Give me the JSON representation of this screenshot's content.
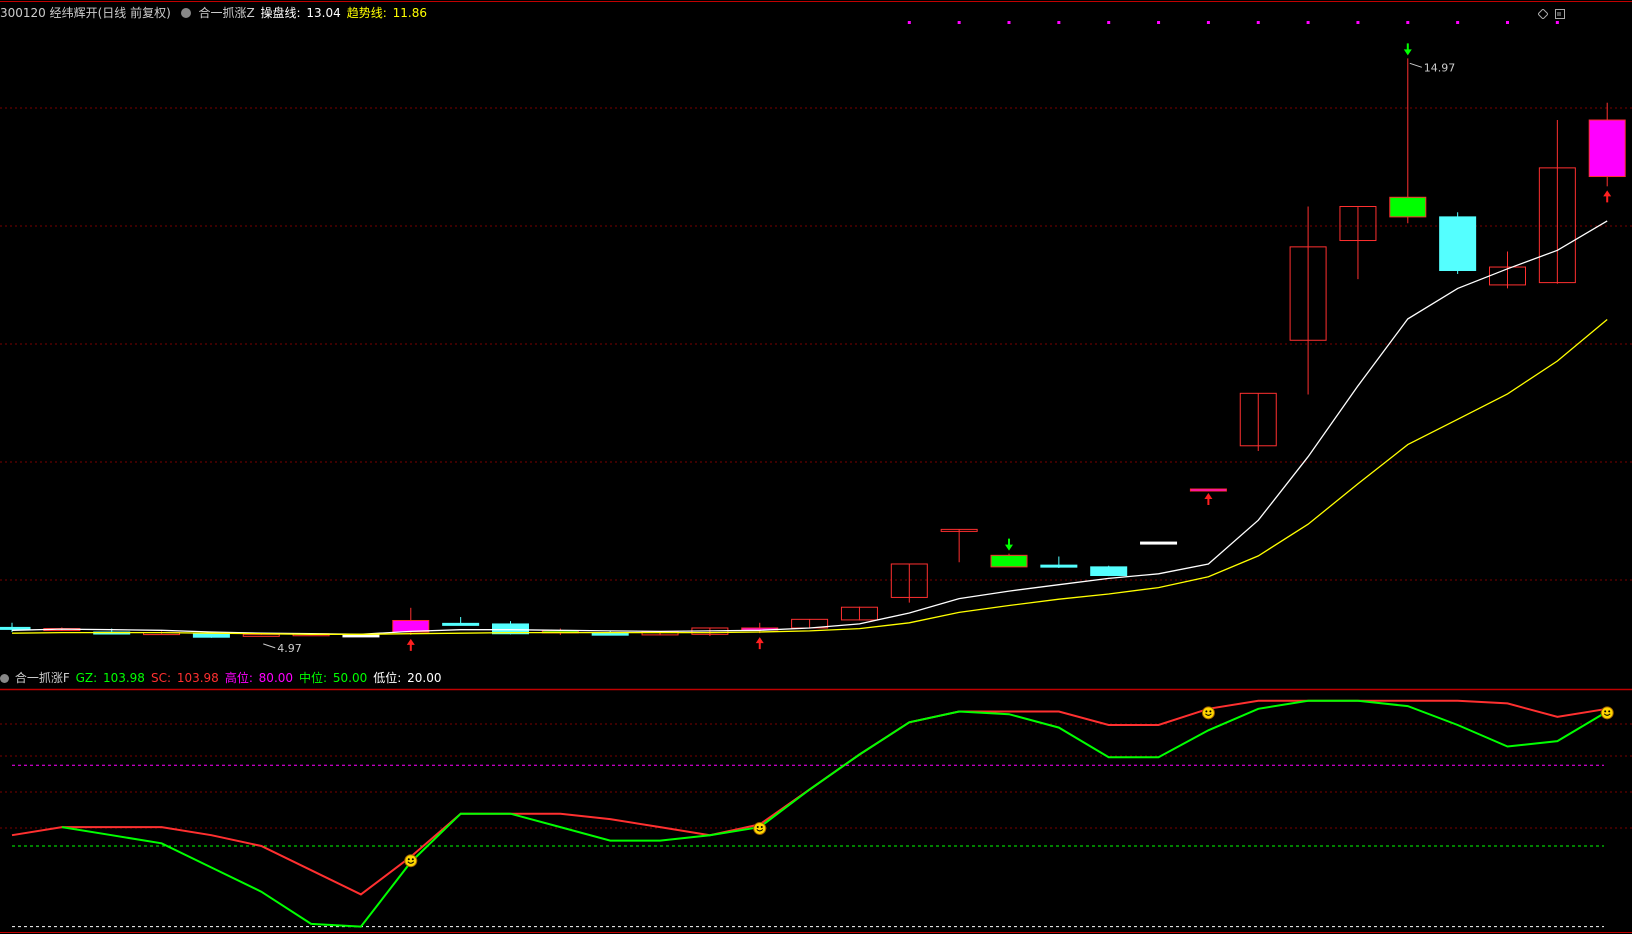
{
  "main_header": {
    "code_name": "300120 经纬辉开(日线 前复权)",
    "indicator": "合一抓涨Z",
    "lines": [
      {
        "label": "操盘线",
        "value": "13.04",
        "color": "#ffffff"
      },
      {
        "label": "趋势线",
        "value": "11.86",
        "color": "#ffff00"
      }
    ]
  },
  "sub_header": {
    "indicator": "合一抓涨F",
    "lines": [
      {
        "label": "GZ",
        "value": "103.98",
        "color": "#00ff00"
      },
      {
        "label": "SC",
        "value": "103.98",
        "color": "#ff3030"
      },
      {
        "label": "高位",
        "value": "80.00",
        "color": "#ff00ff"
      },
      {
        "label": "中位",
        "value": "50.00",
        "color": "#00ff00"
      },
      {
        "label": "低位",
        "value": "20.00",
        "color": "#ffffff"
      }
    ]
  },
  "chart_data": [
    {
      "type": "candlestick",
      "title": "合一抓涨Z",
      "ylim": [
        4.5,
        15.6
      ],
      "grid": true,
      "x_index": [
        1,
        2,
        3,
        4,
        5,
        6,
        7,
        8,
        9,
        10,
        11,
        12,
        13,
        14,
        15,
        16,
        17,
        18,
        19,
        20,
        21,
        22,
        23,
        24,
        25,
        26,
        27,
        28,
        29,
        30,
        31,
        32,
        33
      ],
      "candles": [
        {
          "o": 5.1,
          "h": 5.18,
          "l": 5.02,
          "c": 5.07,
          "color": "cyan"
        },
        {
          "o": 5.07,
          "h": 5.1,
          "l": 5.04,
          "c": 5.08,
          "color": "red"
        },
        {
          "o": 5.02,
          "h": 5.08,
          "l": 4.98,
          "c": 4.99,
          "color": "cyan"
        },
        {
          "o": 5.01,
          "h": 5.03,
          "l": 4.99,
          "c": 5.01,
          "color": "red"
        },
        {
          "o": 5.0,
          "h": 5.0,
          "l": 4.92,
          "c": 4.93,
          "color": "cyan"
        },
        {
          "o": 4.97,
          "h": 4.98,
          "l": 4.97,
          "c": 4.98,
          "color": "red"
        },
        {
          "o": 4.98,
          "h": 4.99,
          "l": 4.97,
          "c": 4.99,
          "color": "red"
        },
        {
          "o": 4.97,
          "h": 4.98,
          "l": 4.96,
          "c": 4.97,
          "color": "white"
        },
        {
          "o": 5.02,
          "h": 5.44,
          "l": 4.97,
          "c": 5.22,
          "color": "magenta"
        },
        {
          "o": 5.17,
          "h": 5.28,
          "l": 5.17,
          "c": 5.17,
          "color": "cyan"
        },
        {
          "o": 5.16,
          "h": 5.21,
          "l": 4.98,
          "c": 4.99,
          "color": "cyan"
        },
        {
          "o": 5.04,
          "h": 5.08,
          "l": 4.97,
          "c": 5.04,
          "color": "green"
        },
        {
          "o": 5.0,
          "h": 5.03,
          "l": 4.98,
          "c": 4.99,
          "color": "cyan"
        },
        {
          "o": 4.97,
          "h": 5.03,
          "l": 4.97,
          "c": 5.03,
          "color": "red"
        },
        {
          "o": 4.98,
          "h": 5.09,
          "l": 4.95,
          "c": 5.09,
          "color": "red"
        },
        {
          "o": 5.09,
          "h": 5.18,
          "l": 5.0,
          "c": 5.09,
          "color": "magenta"
        },
        {
          "o": 5.09,
          "h": 5.24,
          "l": 5.08,
          "c": 5.24,
          "color": "red"
        },
        {
          "o": 5.23,
          "h": 5.46,
          "l": 5.22,
          "c": 5.45,
          "color": "red"
        },
        {
          "o": 5.62,
          "h": 6.2,
          "l": 5.53,
          "c": 6.2,
          "color": "red"
        },
        {
          "o": 6.8,
          "h": 6.8,
          "l": 6.23,
          "c": 6.8,
          "color": "red"
        },
        {
          "o": 6.35,
          "h": 6.38,
          "l": 6.15,
          "c": 6.15,
          "color": "green"
        },
        {
          "o": 6.18,
          "h": 6.33,
          "l": 6.13,
          "c": 6.15,
          "color": "cyan"
        },
        {
          "o": 6.15,
          "h": 6.17,
          "l": 5.99,
          "c": 6.0,
          "color": "cyan"
        },
        {
          "o": 6.58,
          "h": 6.58,
          "l": 6.58,
          "c": 6.58,
          "color": "white"
        },
        {
          "o": 7.5,
          "h": 7.5,
          "l": 7.5,
          "c": 7.5,
          "color": "magenta"
        },
        {
          "o": 8.25,
          "h": 9.16,
          "l": 8.16,
          "c": 9.16,
          "color": "red"
        },
        {
          "o": 10.08,
          "h": 12.4,
          "l": 9.14,
          "c": 11.7,
          "color": "red"
        },
        {
          "o": 11.81,
          "h": 12.39,
          "l": 11.14,
          "c": 12.4,
          "color": "red"
        },
        {
          "o": 12.56,
          "h": 14.97,
          "l": 12.11,
          "c": 12.22,
          "color": "green"
        },
        {
          "o": 12.22,
          "h": 12.3,
          "l": 11.23,
          "c": 11.29,
          "color": "cyan"
        },
        {
          "o": 11.35,
          "h": 11.62,
          "l": 10.98,
          "c": 11.04,
          "color": "red"
        },
        {
          "o": 11.08,
          "h": 13.9,
          "l": 11.06,
          "c": 13.07,
          "color": "red"
        },
        {
          "o": 12.92,
          "h": 14.2,
          "l": 12.75,
          "c": 13.9,
          "color": "magenta"
        }
      ],
      "series": [
        {
          "name": "操盘线",
          "color": "#ffffff",
          "values": [
            5.05,
            5.07,
            5.06,
            5.05,
            5.02,
            5.0,
            4.99,
            4.98,
            5.03,
            5.06,
            5.06,
            5.05,
            5.04,
            5.03,
            5.04,
            5.05,
            5.09,
            5.16,
            5.35,
            5.6,
            5.73,
            5.84,
            5.95,
            6.03,
            6.2,
            6.96,
            8.06,
            9.29,
            10.45,
            10.98,
            11.32,
            11.64,
            12.15
          ]
        },
        {
          "name": "趋势线",
          "color": "#ffff00",
          "values": [
            5.0,
            5.01,
            5.01,
            5.01,
            5.0,
            4.99,
            4.98,
            4.98,
            4.99,
            5.0,
            5.01,
            5.01,
            5.01,
            5.01,
            5.01,
            5.02,
            5.04,
            5.08,
            5.18,
            5.36,
            5.48,
            5.59,
            5.68,
            5.79,
            5.98,
            6.34,
            6.89,
            7.59,
            8.27,
            8.71,
            9.15,
            9.72,
            10.44
          ]
        }
      ],
      "annotations": [
        {
          "text": "4.97",
          "type": "low",
          "index": 6
        },
        {
          "text": "14.97",
          "type": "high",
          "index": 29
        }
      ],
      "arrows_up_red": [
        9,
        16,
        25,
        33
      ],
      "arrows_down_green": [
        21,
        29
      ],
      "top_markers_magenta": [
        19,
        20,
        21,
        22,
        23,
        24,
        25,
        26,
        27,
        28,
        29,
        30,
        31,
        32
      ]
    },
    {
      "type": "line",
      "title": "合一抓涨F",
      "ylim": [
        18,
        108
      ],
      "x_index": [
        1,
        2,
        3,
        4,
        5,
        6,
        7,
        8,
        9,
        10,
        11,
        12,
        13,
        14,
        15,
        16,
        17,
        18,
        19,
        20,
        21,
        22,
        23,
        24,
        25,
        26,
        27,
        28,
        29,
        30,
        31,
        32,
        33
      ],
      "series": [
        {
          "name": "GZ",
          "color": "#00ff00",
          "values": [
            null,
            57,
            54,
            51,
            42,
            33,
            21,
            20,
            44,
            62,
            62,
            57,
            52,
            52,
            54,
            57,
            71,
            84,
            96,
            100,
            99,
            94,
            83,
            83,
            93,
            101,
            104,
            104,
            102,
            95,
            87,
            89,
            100
          ]
        },
        {
          "name": "SC",
          "color": "#ff3030",
          "values": [
            54,
            57,
            57,
            57,
            54,
            50,
            41,
            32,
            46,
            62,
            62,
            62,
            60,
            57,
            54,
            58,
            71,
            84,
            96,
            100,
            100,
            100,
            95,
            95,
            101,
            104,
            104,
            104,
            104,
            104,
            103,
            98,
            101
          ]
        }
      ],
      "hlines": [
        {
          "label": "高位",
          "value": 80,
          "color": "#ff00ff"
        },
        {
          "label": "中位",
          "value": 50,
          "color": "#00ff00"
        },
        {
          "label": "低位",
          "value": 20,
          "color": "#ffffff"
        }
      ],
      "smiley_markers": [
        9,
        16,
        25,
        33
      ]
    }
  ]
}
